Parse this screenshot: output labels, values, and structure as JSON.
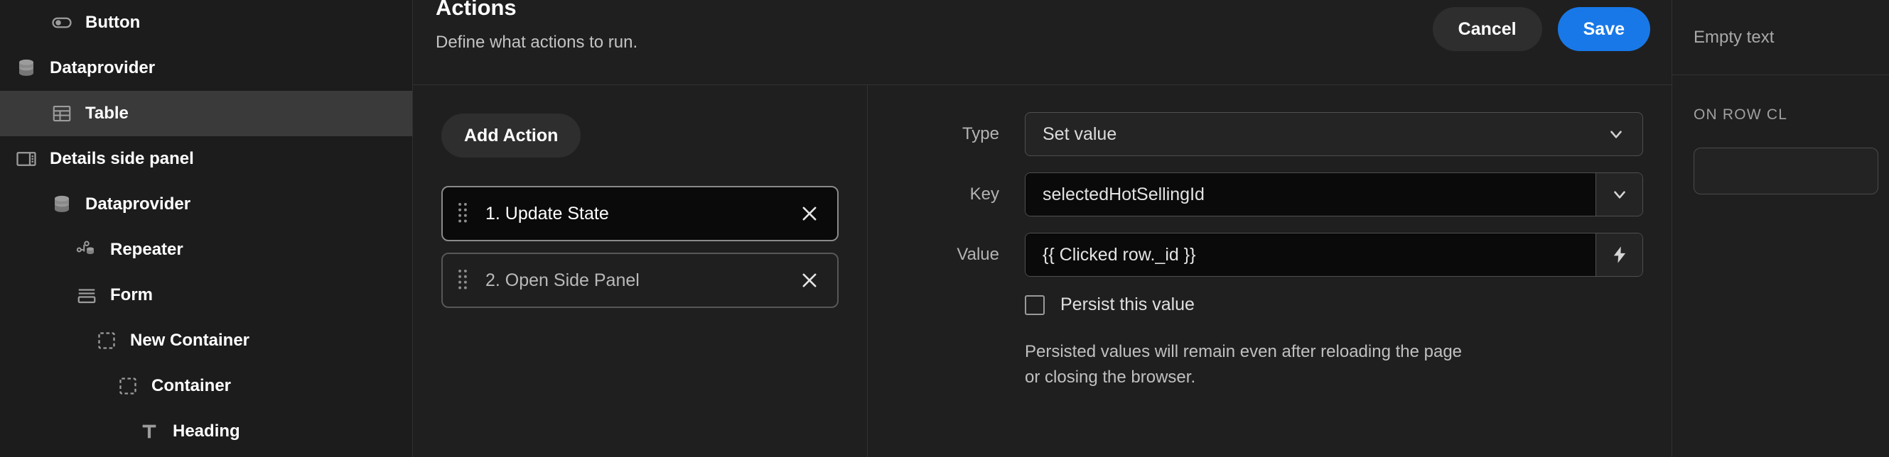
{
  "sidebar": {
    "items": [
      {
        "label": "Button",
        "icon": "toggle-icon",
        "level": 2,
        "selected": false
      },
      {
        "label": "Dataprovider",
        "icon": "database-icon",
        "level": 1,
        "selected": false
      },
      {
        "label": "Table",
        "icon": "table-icon",
        "level": 2,
        "selected": true
      },
      {
        "label": "Details side panel",
        "icon": "side-panel-icon",
        "level": 1,
        "selected": false
      },
      {
        "label": "Dataprovider",
        "icon": "database-icon",
        "level": 2,
        "selected": false
      },
      {
        "label": "Repeater",
        "icon": "repeater-icon",
        "level": 3,
        "selected": false
      },
      {
        "label": "Form",
        "icon": "form-icon",
        "level": 4,
        "selected": false
      },
      {
        "label": "New Container",
        "icon": "container-icon",
        "level": 5,
        "selected": false
      },
      {
        "label": "Container",
        "icon": "container-icon",
        "level": 6,
        "selected": false
      },
      {
        "label": "Heading",
        "icon": "text-heading-icon",
        "level": 7,
        "selected": false
      }
    ]
  },
  "modal": {
    "title": "Actions",
    "subtitle": "Define what actions to run.",
    "cancel_label": "Cancel",
    "save_label": "Save",
    "save_color": "#1878e8",
    "add_action_label": "Add Action",
    "actions": [
      {
        "label": "1. Update State",
        "active": true
      },
      {
        "label": "2. Open Side Panel",
        "active": false
      }
    ],
    "config": {
      "type_label": "Type",
      "type_value": "Set value",
      "key_label": "Key",
      "key_value": "selectedHotSellingId",
      "value_label": "Value",
      "value_value": "{{ Clicked row._id }}",
      "persist_label": "Persist this value",
      "persist_checked": false,
      "help_text": "Persisted values will remain even after reloading the page or closing the browser."
    }
  },
  "inspector": {
    "empty_text": "Empty text",
    "section_title": "ON ROW CL"
  }
}
